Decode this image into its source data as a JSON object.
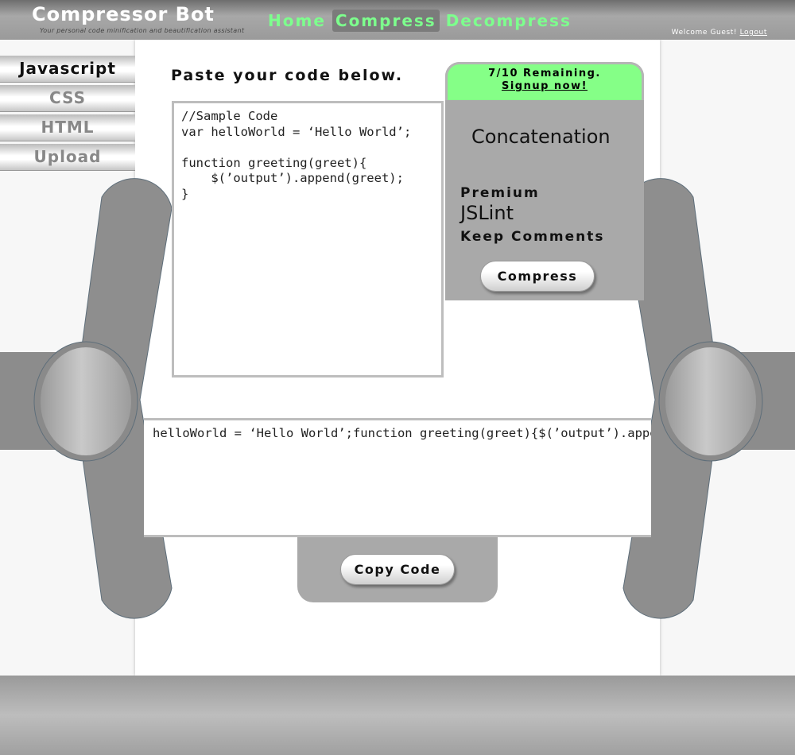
{
  "header": {
    "brand": "Compressor Bot",
    "tagline": "Your personal code minification and beautification assistant",
    "nav": [
      {
        "label": "Home",
        "active": false
      },
      {
        "label": "Compress",
        "active": true
      },
      {
        "label": "Decompress",
        "active": false
      }
    ],
    "welcome_text": "Welcome Guest!",
    "logout_label": "Logout"
  },
  "sidebar": {
    "tabs": [
      {
        "label": "Javascript",
        "active": true
      },
      {
        "label": "CSS",
        "active": false
      },
      {
        "label": "HTML",
        "active": false
      },
      {
        "label": "Upload",
        "active": false
      }
    ]
  },
  "main": {
    "heading": "Paste your code below.",
    "input_code": "//Sample Code\nvar helloWorld = ‘Hello World’;\n\nfunction greeting(greet){\n    $(’output’).append(greet);\n}",
    "output_code": "helloWorld = ‘Hello World’;function greeting(greet){$(’output’).append(greet);}"
  },
  "options": {
    "remaining_text": "7/10 Remaining.",
    "signup_label": "Signup now!",
    "concatenation_label": "Concatenation",
    "premium_label": "Premium",
    "jslint_label": "JSLint",
    "keep_comments_label": "Keep Comments",
    "compress_label": "Compress"
  },
  "actions": {
    "copy_label": "Copy Code"
  },
  "colors": {
    "accent_green": "#7dff8d",
    "banner_green": "#85ff87",
    "panel_gray": "#a9a9a9"
  }
}
